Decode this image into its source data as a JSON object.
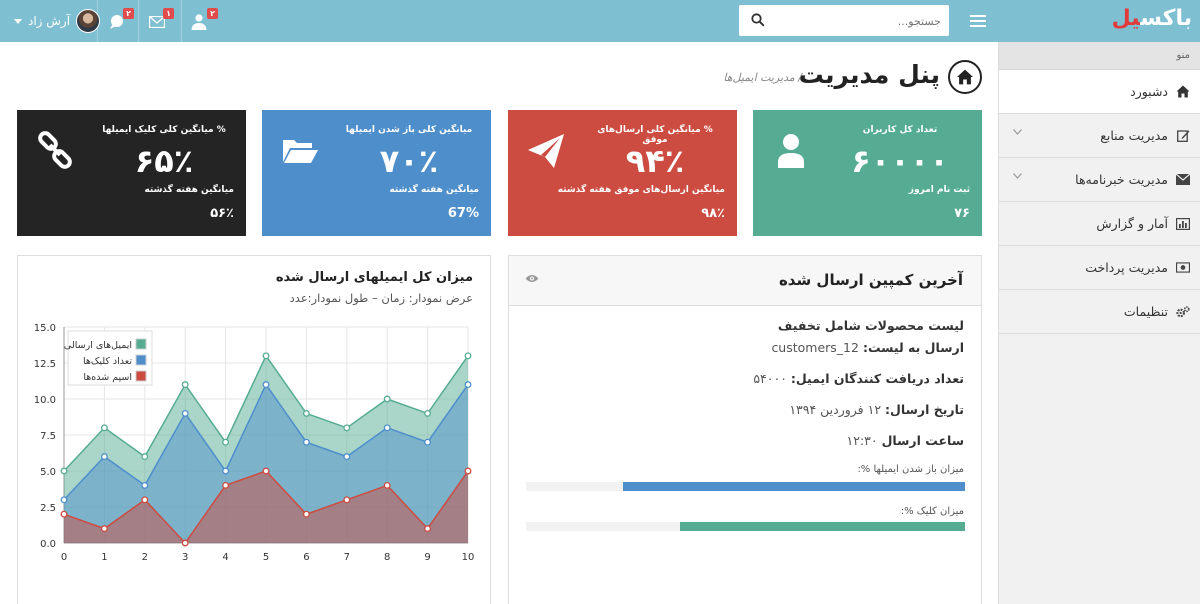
{
  "topbar": {
    "logo_main": "باکس",
    "logo_accent": "یل",
    "search_placeholder": "جستجو...",
    "user_name": "آرش زاد",
    "badges": {
      "messages": "۲",
      "mail": "۱",
      "users": "۲"
    }
  },
  "sidebar": {
    "title": "منو",
    "items": [
      {
        "label": "دشبورد",
        "icon": "home-icon",
        "active": true
      },
      {
        "label": "مدیریت منابع",
        "icon": "edit-icon",
        "chevron": true
      },
      {
        "label": "مدیریت خبرنامه‌ها",
        "icon": "envelope-icon",
        "chevron": true
      },
      {
        "label": "آمار و گزارش",
        "icon": "bar-chart-icon"
      },
      {
        "label": "مدیریت پرداخت",
        "icon": "money-icon"
      },
      {
        "label": "تنظیمات",
        "icon": "gears-icon"
      }
    ]
  },
  "header": {
    "title": "پنل مدیریت",
    "breadcrumb": "/ مدیریت ایمیل‌ها"
  },
  "tiles": [
    {
      "label": "تعداد کل کاربران",
      "value": "۶۰۰۰۰",
      "sub_label": "ثبت نام امروز",
      "sub_value": "۷۶",
      "color": "#56ac93",
      "icon": "user-icon"
    },
    {
      "label": "% میانگین کلی ارسال‌های موفق",
      "value": "۹۴٪",
      "sub_label": "میانگین ارسال‌های موفق هفته گذشته",
      "sub_value": "۹۸٪",
      "color": "#cc4c41",
      "icon": "paper-plane-icon"
    },
    {
      "label": "میانگین کلی باز شدن ایمیلها",
      "value": "۷۰٪",
      "sub_label": "میانگین هفته گذشته",
      "sub_value": "67%",
      "color": "#4e8fcb",
      "icon": "folder-open-icon"
    },
    {
      "label": "% میانگین کلی کلیک ایمیلها",
      "value": "۶۵٪",
      "sub_label": "میانگین هفته گذشته",
      "sub_value": "۵۶٪",
      "color": "#242424",
      "icon": "link-icon"
    }
  ],
  "campaign": {
    "title": "آخرین کمپین ارسال شده",
    "name": "لیست محصولات شامل تخفیف",
    "list_label": "ارسال به لیست:",
    "list_value": "customers_12",
    "recipients_label": "تعداد دریافت کنندگان ایمیل:",
    "recipients_value": "۵۴۰۰۰",
    "date_label": "تاریخ ارسال:",
    "date_value": "۱۲ فروردین ۱۳۹۴",
    "time_label": "ساعت ارسال",
    "time_value": "۱۲:۳۰",
    "open_rate_label": "میزان باز شدن ایمیلها %:",
    "open_rate": 0.78,
    "open_color": "#4e8fcb",
    "click_rate_label": "میزان کلیک %:",
    "click_rate": 0.65,
    "click_color": "#56ac93"
  },
  "chart_panel": {
    "title": "میزان کل ایمیلهای ارسال شده",
    "subtitle": "عرض نمودار: زمان – طول نمودار:عدد"
  },
  "chart_data": {
    "type": "area",
    "x": [
      0,
      1,
      2,
      3,
      4,
      5,
      6,
      7,
      8,
      9,
      10
    ],
    "series": [
      {
        "name": "ایمیل‌های ارسالی",
        "values": [
          5,
          8,
          6,
          11,
          7,
          13,
          9,
          8,
          10,
          9,
          13
        ],
        "color": "#56ac93"
      },
      {
        "name": "تعداد کلیک‌ها",
        "values": [
          3,
          6,
          4,
          9,
          5,
          11,
          7,
          6,
          8,
          7,
          11
        ],
        "color": "#4e8fcb"
      },
      {
        "name": "اسپم شده‌ها",
        "values": [
          2,
          1,
          3,
          0,
          4,
          5,
          2,
          3,
          4,
          1,
          5
        ],
        "color": "#cc4c41"
      }
    ],
    "xlim": [
      0,
      10
    ],
    "ylim": [
      0,
      15
    ],
    "yticks": [
      "0.0",
      "2.5",
      "5.0",
      "7.5",
      "10.0",
      "12.5",
      "15.0"
    ],
    "xticks": [
      "0",
      "1",
      "2",
      "3",
      "4",
      "5",
      "6",
      "7",
      "8",
      "9",
      "10"
    ],
    "legend": "top-left",
    "grid": true
  }
}
